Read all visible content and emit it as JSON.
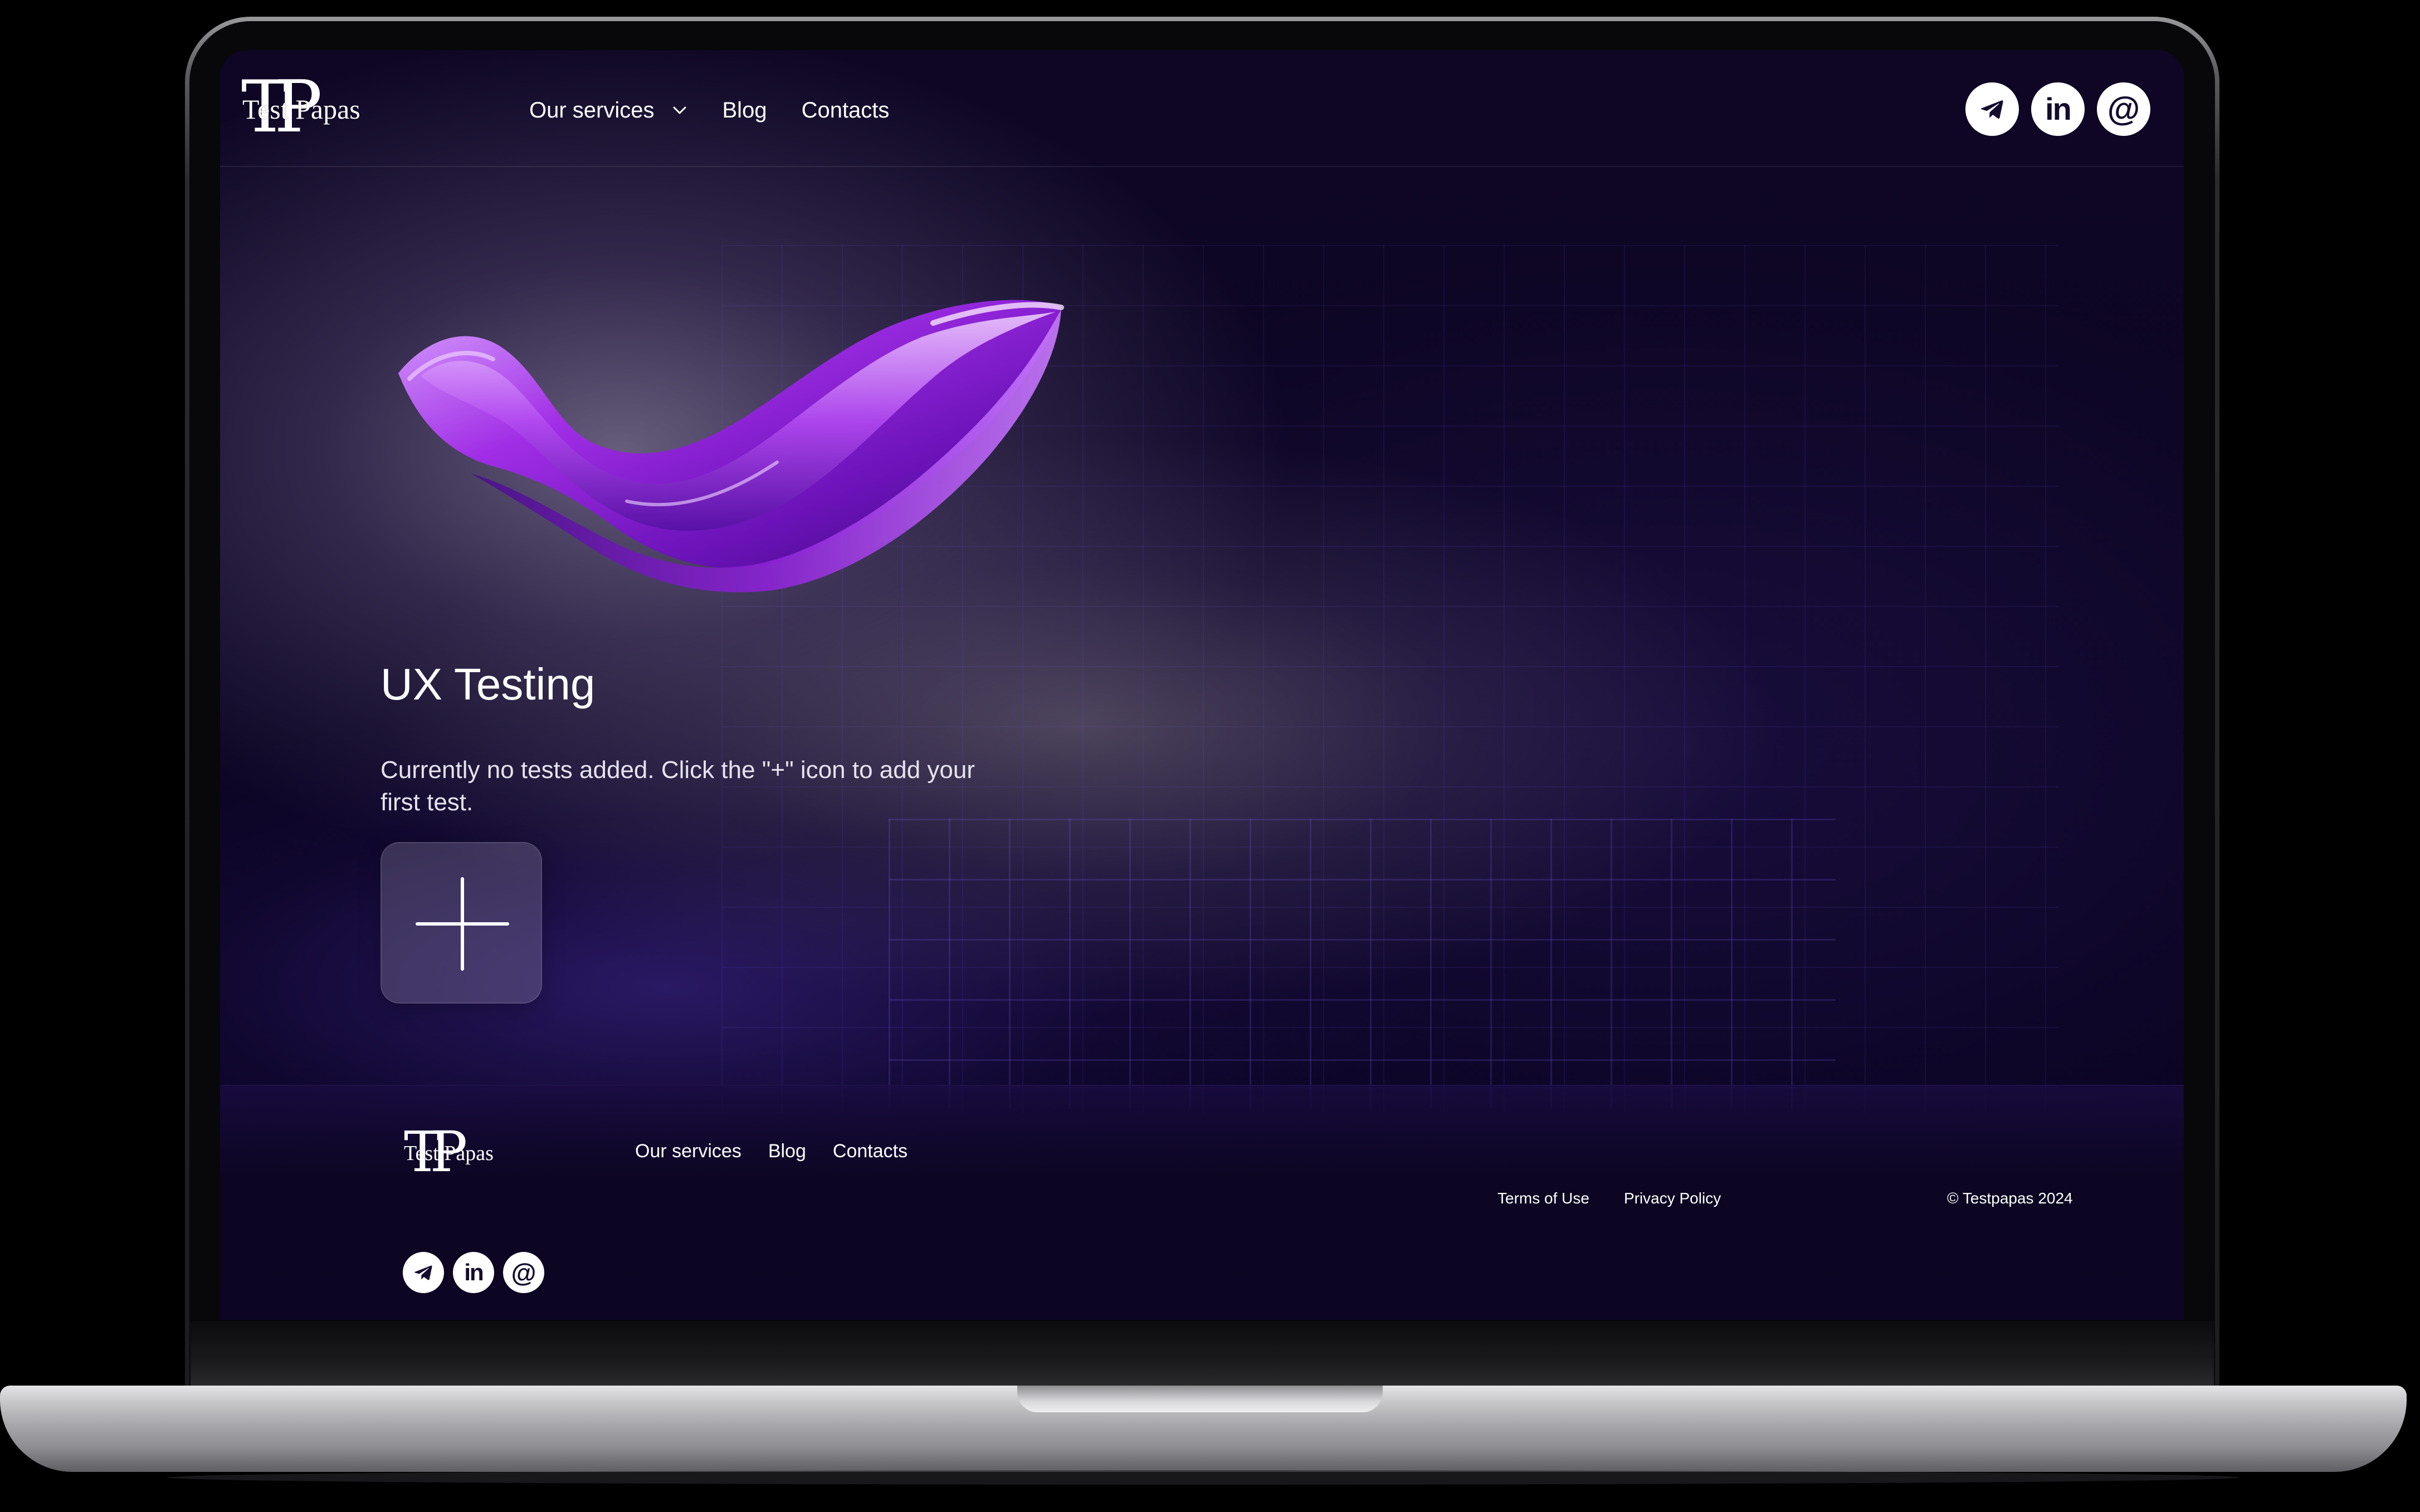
{
  "brand": {
    "monogram": "TP",
    "name": "Test Papas"
  },
  "header": {
    "nav": [
      {
        "label": "Our services",
        "has_dropdown": true
      },
      {
        "label": "Blog"
      },
      {
        "label": "Contacts"
      }
    ],
    "social": [
      {
        "icon": "telegram-icon"
      },
      {
        "icon": "linkedin-icon",
        "glyph": "in"
      },
      {
        "icon": "email-at-icon",
        "glyph": "@"
      }
    ]
  },
  "hero": {
    "title": "UX Testing",
    "message": "Currently no tests added. Click the \"+\" icon to add your first test.",
    "add_button_icon": "plus-icon"
  },
  "footer": {
    "nav": [
      {
        "label": "Our services"
      },
      {
        "label": "Blog"
      },
      {
        "label": "Contacts"
      }
    ],
    "legal": [
      {
        "label": "Terms of Use"
      },
      {
        "label": "Privacy Policy"
      }
    ],
    "copyright": "© Testpapas 2024"
  },
  "colors": {
    "background": "#0c0624",
    "accent": "#8a3cf0",
    "text": "#ffffff"
  }
}
